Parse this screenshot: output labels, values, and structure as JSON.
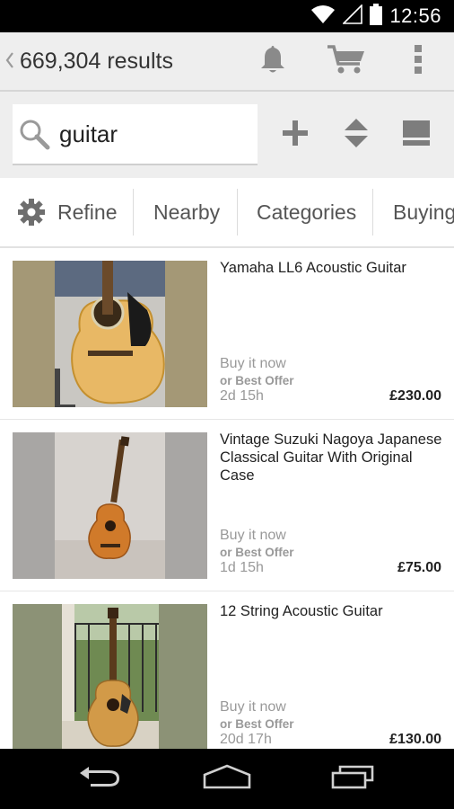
{
  "status_bar": {
    "time": "12:56",
    "icons": [
      "wifi-icon",
      "signal-icon",
      "battery-icon"
    ]
  },
  "app_bar": {
    "results_count": "669,304 results",
    "icons": [
      "back-chevron-icon",
      "bell-icon",
      "cart-icon",
      "overflow-menu-icon"
    ]
  },
  "search": {
    "query": "guitar",
    "icons": [
      "search-icon",
      "plus-icon",
      "sort-icon",
      "view-toggle-icon"
    ]
  },
  "filters": {
    "tabs": [
      "Refine",
      "Nearby",
      "Categories",
      "Buying"
    ],
    "refine_icon": "gear-icon"
  },
  "listings": [
    {
      "title": "Yamaha LL6 Acoustic Guitar",
      "format": "Buy it now",
      "offer": "or Best Offer",
      "time_left": "2d 15h",
      "price": "£230.00"
    },
    {
      "title": "Vintage Suzuki Nagoya Japanese Classical Guitar With Original Case",
      "format": "Buy it now",
      "offer": "or Best Offer",
      "time_left": "1d 15h",
      "price": "£75.00"
    },
    {
      "title": "12 String Acoustic Guitar",
      "format": "Buy it now",
      "offer": "or Best Offer",
      "time_left": "20d 17h",
      "price": "£130.00"
    }
  ],
  "nav_bar": {
    "icons": [
      "back-icon",
      "home-icon",
      "recent-apps-icon"
    ]
  },
  "colors": {
    "app_bar_bg": "#eeeeee",
    "icon_gray": "#8a8a8a",
    "text_muted": "#999999"
  }
}
